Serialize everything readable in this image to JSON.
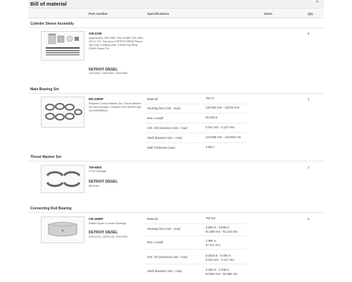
{
  "panel": {
    "title": "Bill of material"
  },
  "columns": {
    "part_number": "Part number",
    "specifications": "Specifications",
    "sizes": "Sizes",
    "qty": "Qty"
  },
  "items": [
    {
      "section": "Cylinder Sleeve Assembly",
      "part_number": "226-2106",
      "description": "supersedes: 226-1950, 226-2106M, 226-1950, 16.9:1 CR, Two piece FERROTHERM Piston; Top Liner Cooling-Liner, 3.6MM Top Ring, 22MM Piston Pin",
      "brand": "DETROIT DIESEL",
      "refs": "23532562, 23532564, 23530869",
      "qty": "6",
      "specs": []
    },
    {
      "section": "Main Bearing Set",
      "part_number": "MS-2093P",
      "description": "Requires Thrust Washer Set, Thrust Washer Set Not Included, Contains OE# 8929670(6) And 8929680(1)",
      "brand": "",
      "refs": "",
      "qty": "1",
      "specs": [
        {
          "label": "Material",
          "value": "TM-77"
        },
        {
          "label": "Housing bore (min - max)",
          "value": "132.994 mm - 133.02 mm"
        },
        {
          "label": "Max. Length",
          "value": "39.446 in"
        },
        {
          "label": "Vert. Oil Clearance (min - max)",
          "value": "0.041 mm - 0.127 mm"
        },
        {
          "label": "Shaft diameter (min - max)",
          "value": "124.968 mm - 124.993 mm"
        },
        {
          "label": "Wall Thickness (max)",
          "value": "3.98 in"
        }
      ]
    },
    {
      "section": "Thrust Washer Set",
      "part_number": "TW-600S",
      "description": "2 Per Package",
      "brand": "DETROIT DIESEL",
      "refs": "8929085",
      "qty": "1",
      "specs": []
    },
    {
      "section": "Connecting Rod Bearing",
      "part_number": "CB-1836P",
      "description": "Drilled Upper & Lower Bearings",
      "brand": "DETROIT DIESEL",
      "refs": "23526142, 23535745, 23523935",
      "qty": "6",
      "specs": [
        {
          "label": "Material",
          "value": "TM-112"
        },
        {
          "label": "Housing bore (min - max)",
          "value": "3.594 in - 3.595 in",
          "value2": "91.288 mm - 91.313 mm"
        },
        {
          "label": "Max. Length",
          "value": "1.865 in",
          "value2": "47.371 mm"
        },
        {
          "label": "Vert. Oil Clearance (min - max)",
          "value": "0.0016 in - 0.005 in",
          "value2": "0.041 mm - 0.117 mm"
        },
        {
          "label": "Shaft diameter (min - max)",
          "value": "3.345 in - 3.346 in",
          "value2": "84.963 mm - 84.988 mm"
        }
      ]
    }
  ]
}
